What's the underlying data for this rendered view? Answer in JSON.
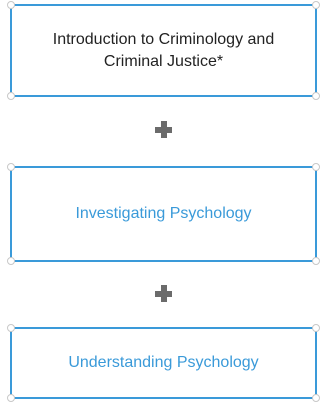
{
  "modules": [
    {
      "label": "Introduction to Criminology and Criminal Justice*"
    },
    {
      "label": "Investigating Psychology"
    },
    {
      "label": "Understanding Psychology"
    }
  ],
  "connector_icon": "plus-icon",
  "colors": {
    "border": "#3a9ad9",
    "link_text": "#3a9ad9",
    "text": "#222222",
    "plus": "#6b6b6b",
    "corner_dot_border": "#c8c8c8"
  }
}
